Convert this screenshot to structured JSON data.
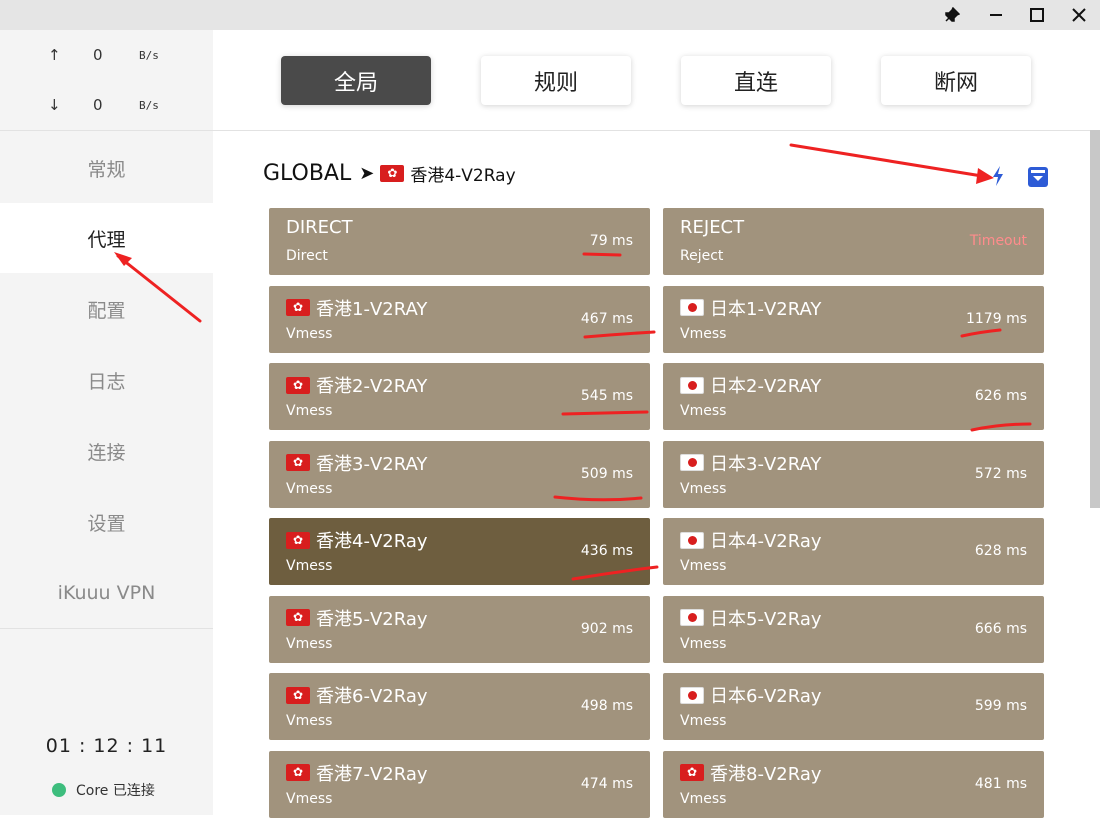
{
  "window_controls": {
    "pin_icon": "pin-icon",
    "minimize_icon": "minimize-icon",
    "maximize_icon": "maximize-icon",
    "close_icon": "close-icon"
  },
  "traffic": {
    "up_arrow": "↑",
    "down_arrow": "↓",
    "upload_value": "0",
    "upload_unit": "B/s",
    "download_value": "0",
    "download_unit": "B/s"
  },
  "nav": {
    "items": [
      {
        "label": "常规"
      },
      {
        "label": "代理"
      },
      {
        "label": "配置"
      },
      {
        "label": "日志"
      },
      {
        "label": "连接"
      },
      {
        "label": "设置"
      },
      {
        "label": "iKuuu VPN"
      }
    ],
    "active_index": 1
  },
  "status": {
    "uptime": "01 : 12 : 11",
    "core_label": "Core 已连接",
    "core_color": "#3dbd7d"
  },
  "modes": {
    "items": [
      {
        "label": "全局"
      },
      {
        "label": "规则"
      },
      {
        "label": "直连"
      },
      {
        "label": "断网"
      }
    ],
    "active_index": 0
  },
  "group": {
    "name": "GLOBAL",
    "separator": "➤",
    "selected_flag": "hk",
    "selected_proxy": "香港4-V2Ray",
    "speedtest_icon": "lightning-icon",
    "collapse_icon": "collapse-icon"
  },
  "colors": {
    "card_bg": "#a1937d",
    "card_selected_bg": "#6e5e3f",
    "active_mode_bg": "#4a4a4a",
    "timeout_color": "#ff8c8c",
    "icon_blue": "#2d5bd6"
  },
  "proxies": [
    {
      "name": "DIRECT",
      "type": "Direct",
      "delay": "79 ms",
      "flag": ""
    },
    {
      "name": "REJECT",
      "type": "Reject",
      "delay": "Timeout",
      "flag": "",
      "timeout": true
    },
    {
      "name": "香港1-V2RAY",
      "type": "Vmess",
      "delay": "467 ms",
      "flag": "hk"
    },
    {
      "name": "日本1-V2RAY",
      "type": "Vmess",
      "delay": "1179 ms",
      "flag": "jp"
    },
    {
      "name": "香港2-V2RAY",
      "type": "Vmess",
      "delay": "545 ms",
      "flag": "hk"
    },
    {
      "name": "日本2-V2RAY",
      "type": "Vmess",
      "delay": "626 ms",
      "flag": "jp"
    },
    {
      "name": "香港3-V2RAY",
      "type": "Vmess",
      "delay": "509 ms",
      "flag": "hk"
    },
    {
      "name": "日本3-V2RAY",
      "type": "Vmess",
      "delay": "572 ms",
      "flag": "jp"
    },
    {
      "name": "香港4-V2Ray",
      "type": "Vmess",
      "delay": "436 ms",
      "flag": "hk",
      "selected": true
    },
    {
      "name": "日本4-V2Ray",
      "type": "Vmess",
      "delay": "628 ms",
      "flag": "jp"
    },
    {
      "name": "香港5-V2Ray",
      "type": "Vmess",
      "delay": "902 ms",
      "flag": "hk"
    },
    {
      "name": "日本5-V2Ray",
      "type": "Vmess",
      "delay": "666 ms",
      "flag": "jp"
    },
    {
      "name": "香港6-V2Ray",
      "type": "Vmess",
      "delay": "498 ms",
      "flag": "hk"
    },
    {
      "name": "日本6-V2Ray",
      "type": "Vmess",
      "delay": "599 ms",
      "flag": "jp"
    },
    {
      "name": "香港7-V2Ray",
      "type": "Vmess",
      "delay": "474 ms",
      "flag": "hk"
    },
    {
      "name": "香港8-V2Ray",
      "type": "Vmess",
      "delay": "481 ms",
      "flag": "hk"
    }
  ]
}
